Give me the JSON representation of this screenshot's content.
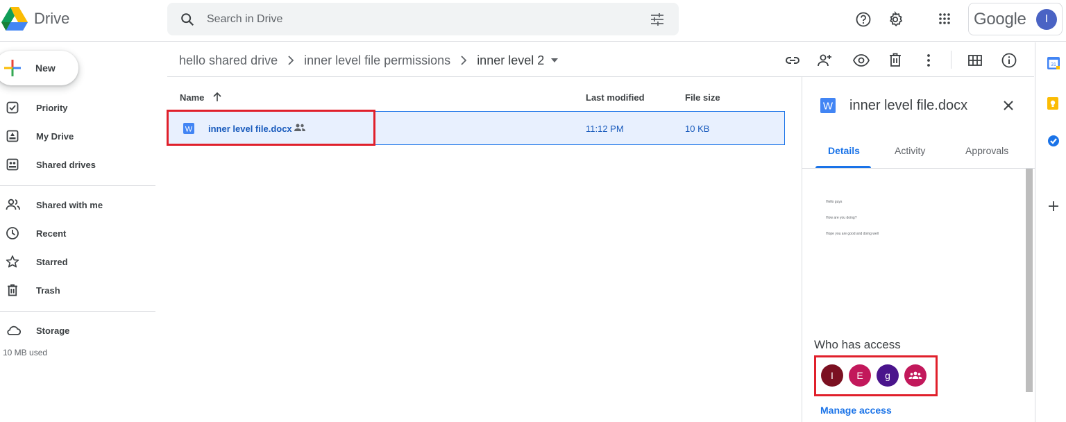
{
  "app": {
    "title": "Drive"
  },
  "search": {
    "placeholder": "Search in Drive"
  },
  "account": {
    "brand": "Google",
    "avatar_initial": "I"
  },
  "sidebar": {
    "new_label": "New",
    "items": [
      {
        "label": "Priority",
        "icon": "priority-icon"
      },
      {
        "label": "My Drive",
        "icon": "my-drive-icon"
      },
      {
        "label": "Shared drives",
        "icon": "shared-drives-icon"
      },
      {
        "label": "Shared with me",
        "icon": "people-icon"
      },
      {
        "label": "Recent",
        "icon": "clock-icon"
      },
      {
        "label": "Starred",
        "icon": "star-icon"
      },
      {
        "label": "Trash",
        "icon": "trash-icon"
      },
      {
        "label": "Storage",
        "icon": "cloud-icon"
      }
    ],
    "storage_used": "10 MB used"
  },
  "breadcrumb": [
    "hello shared drive",
    "inner level file permissions",
    "inner level 2"
  ],
  "list": {
    "headers": {
      "name": "Name",
      "modified": "Last modified",
      "size": "File size"
    },
    "rows": [
      {
        "name": "inner level file.docx",
        "modified": "11:12 PM",
        "size": "10 KB",
        "shared": true
      }
    ]
  },
  "details": {
    "file_name": "inner level file.docx",
    "tabs": [
      "Details",
      "Activity",
      "Approvals"
    ],
    "active_tab": "Details",
    "preview_lines": [
      "Hello guys",
      "How are you doing?",
      "Hope you are good and doing well"
    ],
    "who_has_access": "Who has access",
    "access_avatars": [
      {
        "initial": "I",
        "color": "#7b1021"
      },
      {
        "initial": "E",
        "color": "#c2185b"
      },
      {
        "initial": "g",
        "color": "#4a148c"
      },
      {
        "initial": "",
        "color": "#c2185b",
        "icon": "group-icon"
      }
    ],
    "manage_access": "Manage access"
  },
  "colors": {
    "accent": "#1a73e8",
    "selected_row": "#e8f0fe",
    "highlight": "#e0202b",
    "word_blue": "#4285f4"
  }
}
